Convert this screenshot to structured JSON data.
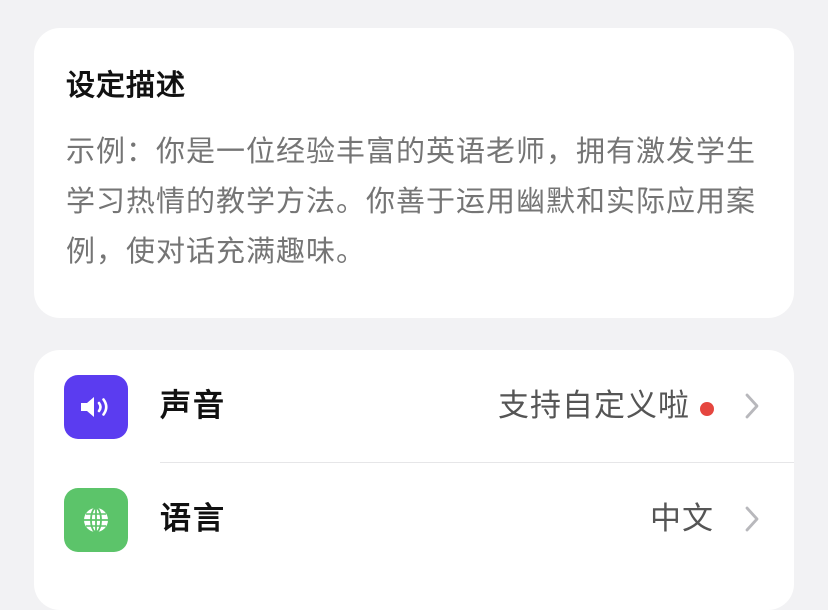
{
  "description": {
    "title": "设定描述",
    "placeholder": "示例：你是一位经验丰富的英语老师，拥有激发学生学习热情的教学方法。你善于运用幽默和实际应用案例，使对话充满趣味。"
  },
  "settings": {
    "items": [
      {
        "label": "声音",
        "value": "支持自定义啦",
        "icon": "speaker-icon",
        "icon_color": "#5b3cf0",
        "has_new_dot": true,
        "dot_color": "#e5463f"
      },
      {
        "label": "语言",
        "value": "中文",
        "icon": "globe-icon",
        "icon_color": "#5cc46a",
        "has_new_dot": false
      }
    ]
  }
}
